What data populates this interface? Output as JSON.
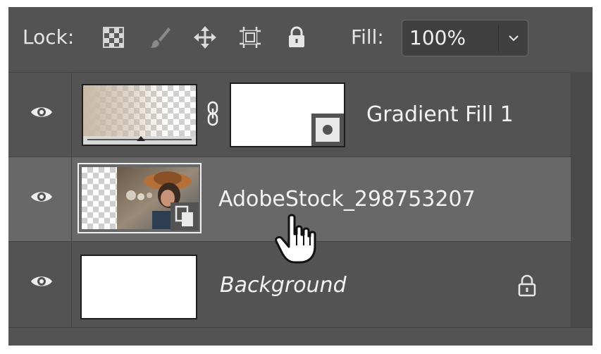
{
  "toolbar": {
    "lock_label": "Lock:",
    "lock_icons": [
      "lock-transparent-pixels-icon",
      "lock-image-pixels-icon",
      "lock-position-icon",
      "lock-artboard-icon",
      "lock-all-icon"
    ],
    "fill_label": "Fill:",
    "fill_value": "100%",
    "fill_dropdown_icon": "chevron-down-icon"
  },
  "layers": [
    {
      "name": "Gradient Fill 1",
      "visible": true,
      "selected": false,
      "has_mask": true,
      "thumbnail": "gradient-fill-thumbnail",
      "link_icon": "chain-link-icon"
    },
    {
      "name": "AdobeStock_298753207",
      "visible": true,
      "selected": true,
      "smart_object": true,
      "thumbnail": "photo-thumbnail"
    },
    {
      "name": "Background",
      "visible": true,
      "selected": false,
      "locked": true,
      "thumbnail": "white-thumbnail",
      "lock_icon": "lock-icon"
    }
  ],
  "cursor": "hand-pointer-icon",
  "colors": {
    "panel_bg": "#535353",
    "selected_row": "#686868",
    "text": "#f2f2f2"
  }
}
